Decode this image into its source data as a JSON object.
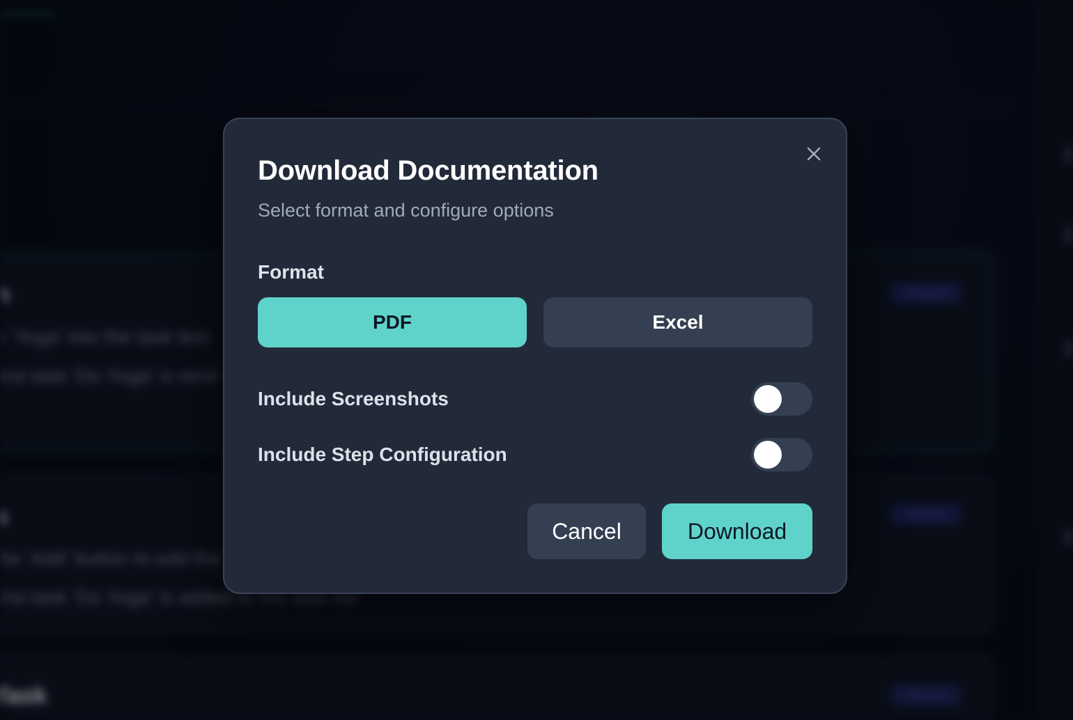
{
  "background": {
    "cards": [
      {
        "title": "n",
        "lines": [
          "e 'Yoga' into the task text",
          "first task 'Do Yoga' is rend"
        ],
        "badge": "Passed"
      },
      {
        "title": "s",
        "lines": [
          "the 'Add' button to add the",
          "first task 'Do Yoga' is added to the task list"
        ],
        "badge": "Passed"
      },
      {
        "title": "Task",
        "lines": [],
        "badge": "Passed"
      }
    ]
  },
  "modal": {
    "title": "Download Documentation",
    "subtitle": "Select format and configure options",
    "close_icon": "close-icon",
    "format": {
      "label": "Format",
      "options": [
        "PDF",
        "Excel"
      ],
      "selected": "PDF"
    },
    "options": [
      {
        "label": "Include Screenshots",
        "enabled": false
      },
      {
        "label": "Include Step Configuration",
        "enabled": false
      }
    ],
    "actions": {
      "cancel_label": "Cancel",
      "download_label": "Download"
    },
    "colors": {
      "accent": "#5fd3c9",
      "surface": "#222a3a",
      "secondary_button": "#353f52"
    }
  }
}
